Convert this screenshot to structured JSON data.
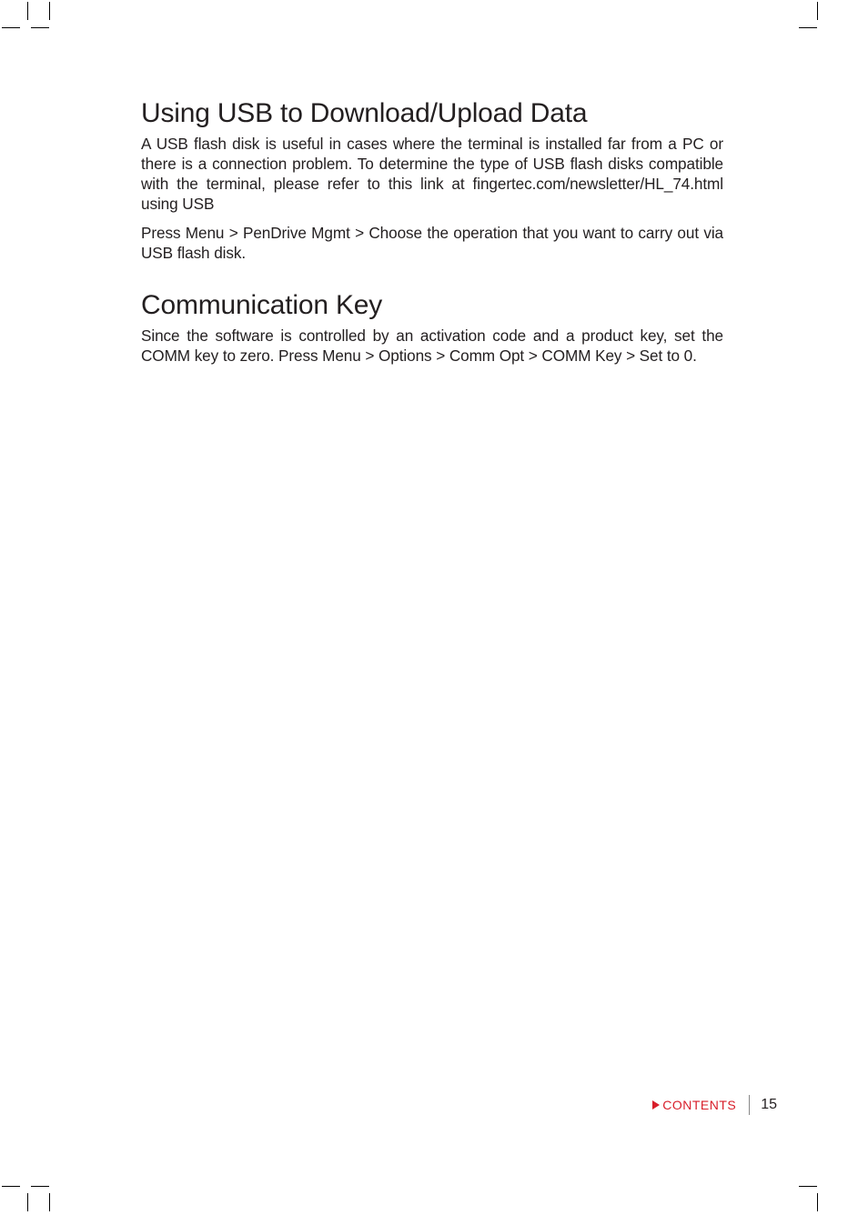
{
  "section1": {
    "heading": "Using USB to Download/Upload Data",
    "p1": "A USB flash disk is useful in cases where the terminal is installed far from a PC or there is a connection problem. To determine the type of USB flash disks compatible with the terminal, please refer to this link at fingertec.com/newsletter/HL_74.html using USB",
    "p2": "Press Menu > PenDrive Mgmt > Choose the operation that you want to carry out via USB flash disk."
  },
  "section2": {
    "heading": "Communication Key",
    "p1": "Since the software is controlled by an activation code and a product key, set the COMM key to zero. Press Menu > Options > Comm Opt > COMM Key > Set to 0."
  },
  "footer": {
    "contents_label": "CONTENTS",
    "page_number": "15"
  }
}
